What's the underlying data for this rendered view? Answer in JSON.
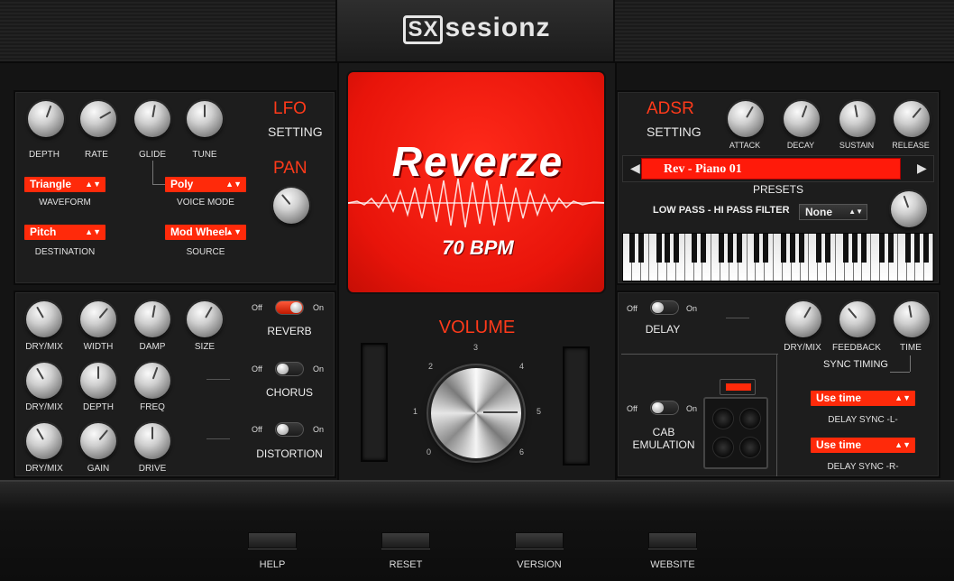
{
  "brand": {
    "logo_sx": "SX",
    "logo_text": "sesionz"
  },
  "lfo": {
    "title": "LFO",
    "subtitle": "SETTING",
    "knobs": [
      "DEPTH",
      "RATE",
      "GLIDE",
      "TUNE"
    ],
    "waveform": {
      "value": "Triangle",
      "label": "WAVEFORM"
    },
    "voice_mode": {
      "value": "Poly",
      "label": "VOICE MODE"
    },
    "destination": {
      "value": "Pitch",
      "label": "DESTINATION"
    },
    "source": {
      "value": "Mod Wheel",
      "label": "SOURCE"
    },
    "pan_title": "PAN"
  },
  "artwork": {
    "title": "Reverze",
    "bpm": "70 BPM"
  },
  "volume": {
    "label": "VOLUME",
    "ticks": [
      "0",
      "1",
      "2",
      "3",
      "4",
      "5",
      "6"
    ]
  },
  "adsr": {
    "title": "ADSR",
    "subtitle": "SETTING",
    "knobs": [
      "ATTACK",
      "DECAY",
      "SUSTAIN",
      "RELEASE"
    ]
  },
  "presets": {
    "current": "Rev - Piano 01",
    "label": "PRESETS",
    "filter_label": "LOW PASS - HI PASS FILTER",
    "filter_value": "None",
    "prev_icon": "◀",
    "next_icon": "▶"
  },
  "effects": {
    "reverb": {
      "name": "REVERB",
      "knobs": [
        "DRY/MIX",
        "WIDTH",
        "DAMP",
        "SIZE"
      ],
      "state": "On"
    },
    "chorus": {
      "name": "CHORUS",
      "knobs": [
        "DRY/MIX",
        "DEPTH",
        "FREQ"
      ],
      "state": "Off"
    },
    "distortion": {
      "name": "DISTORTION",
      "knobs": [
        "DRY/MIX",
        "GAIN",
        "DRIVE"
      ],
      "state": "Off"
    },
    "off_label": "Off",
    "on_label": "On"
  },
  "delay": {
    "name": "DELAY",
    "knobs": [
      "DRY/MIX",
      "FEEDBACK",
      "TIME"
    ],
    "sync_timing": "SYNC TIMING",
    "sync_l": {
      "value": "Use time",
      "label": "DELAY SYNC -L-"
    },
    "sync_r": {
      "value": "Use time",
      "label": "DELAY SYNC -R-"
    }
  },
  "cab": {
    "name": "CAB EMULATION"
  },
  "footer": {
    "buttons": [
      "HELP",
      "RESET",
      "VERSION",
      "WEBSITE"
    ]
  },
  "colors": {
    "accent": "#ff2a0a",
    "panel": "#1d1d1d",
    "background": "#141414"
  }
}
